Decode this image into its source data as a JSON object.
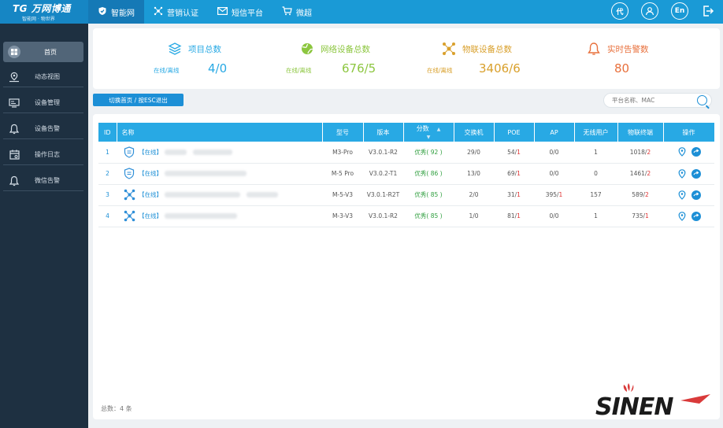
{
  "brand": {
    "name": "TG 万网博通",
    "slogan": "智能网 · 物世界"
  },
  "nav": [
    {
      "label": "智能网",
      "icon": "shield-icon"
    },
    {
      "label": "营销认证",
      "icon": "network-icon"
    },
    {
      "label": "短信平台",
      "icon": "mail-icon"
    },
    {
      "label": "微超",
      "icon": "cart-icon"
    }
  ],
  "top_icons": {
    "agent": "代",
    "lang": "En"
  },
  "sidebar": [
    {
      "label": "首页",
      "icon": "home-icon"
    },
    {
      "label": "动态视图",
      "icon": "map-icon"
    },
    {
      "label": "设备管理",
      "icon": "device-icon"
    },
    {
      "label": "设备告警",
      "icon": "bell-icon"
    },
    {
      "label": "操作日志",
      "icon": "calendar-icon"
    },
    {
      "label": "微信告警",
      "icon": "bell-icon"
    }
  ],
  "stats": [
    {
      "title": "项目总数",
      "label": "在线/离线",
      "value": "4/0",
      "color": "#28a9e4",
      "label_color": "#28a9e4"
    },
    {
      "title": "网络设备总数",
      "label": "在线/离线",
      "value": "676/5",
      "color": "#8cc63f",
      "label_color": "#8cc63f"
    },
    {
      "title": "物联设备总数",
      "label": "在线/离线",
      "value": "3406/6",
      "color": "#d9a02c",
      "label_color": "#d9a02c"
    },
    {
      "title": "实时告警数",
      "label": "",
      "value": "80",
      "color": "#e8703c",
      "label_color": "#e8703c"
    }
  ],
  "toolbar": {
    "switch_label": "切换首页 / 按ESC退出",
    "search_placeholder": "平台名称、MAC"
  },
  "table": {
    "headers": [
      "ID",
      "名称",
      "型号",
      "版本",
      "分数",
      "交换机",
      "POE",
      "AP",
      "无线用户",
      "物联终端",
      "操作"
    ],
    "rows": [
      {
        "id": "1",
        "status": "【在线】",
        "model": "M3-Pro",
        "version": "V3.0.1-R2",
        "score": "优秀( 92 )",
        "switch": "29/0",
        "poe_on": "54/",
        "poe_off": "1",
        "ap_on": "0/0",
        "ap_off": "",
        "wifi": "1",
        "iot_on": "1018/",
        "iot_off": "2",
        "icon": "shield-icon"
      },
      {
        "id": "2",
        "status": "【在线】",
        "model": "M-5 Pro",
        "version": "V3.0.2-T1",
        "score": "优秀( 86 )",
        "switch": "13/0",
        "poe_on": "69/",
        "poe_off": "1",
        "ap_on": "0/0",
        "ap_off": "",
        "wifi": "0",
        "iot_on": "1461/",
        "iot_off": "2",
        "icon": "shield-icon"
      },
      {
        "id": "3",
        "status": "【在线】",
        "model": "M-5-V3",
        "version": "V3.0.1-R2T",
        "score": "优秀( 85 )",
        "switch": "2/0",
        "poe_on": "31/",
        "poe_off": "1",
        "ap_on": "395/",
        "ap_off": "1",
        "wifi": "157",
        "iot_on": "589/",
        "iot_off": "2",
        "icon": "nodes-icon"
      },
      {
        "id": "4",
        "status": "【在线】",
        "model": "M-3-V3",
        "version": "V3.0.1-R2",
        "score": "优秀( 85 )",
        "switch": "1/0",
        "poe_on": "81/",
        "poe_off": "1",
        "ap_on": "0/0",
        "ap_off": "",
        "wifi": "1",
        "iot_on": "735/",
        "iot_off": "1",
        "icon": "nodes-icon"
      }
    ]
  },
  "footer": {
    "total": "总数：4 条"
  },
  "watermark": {
    "text": "SINEN"
  }
}
